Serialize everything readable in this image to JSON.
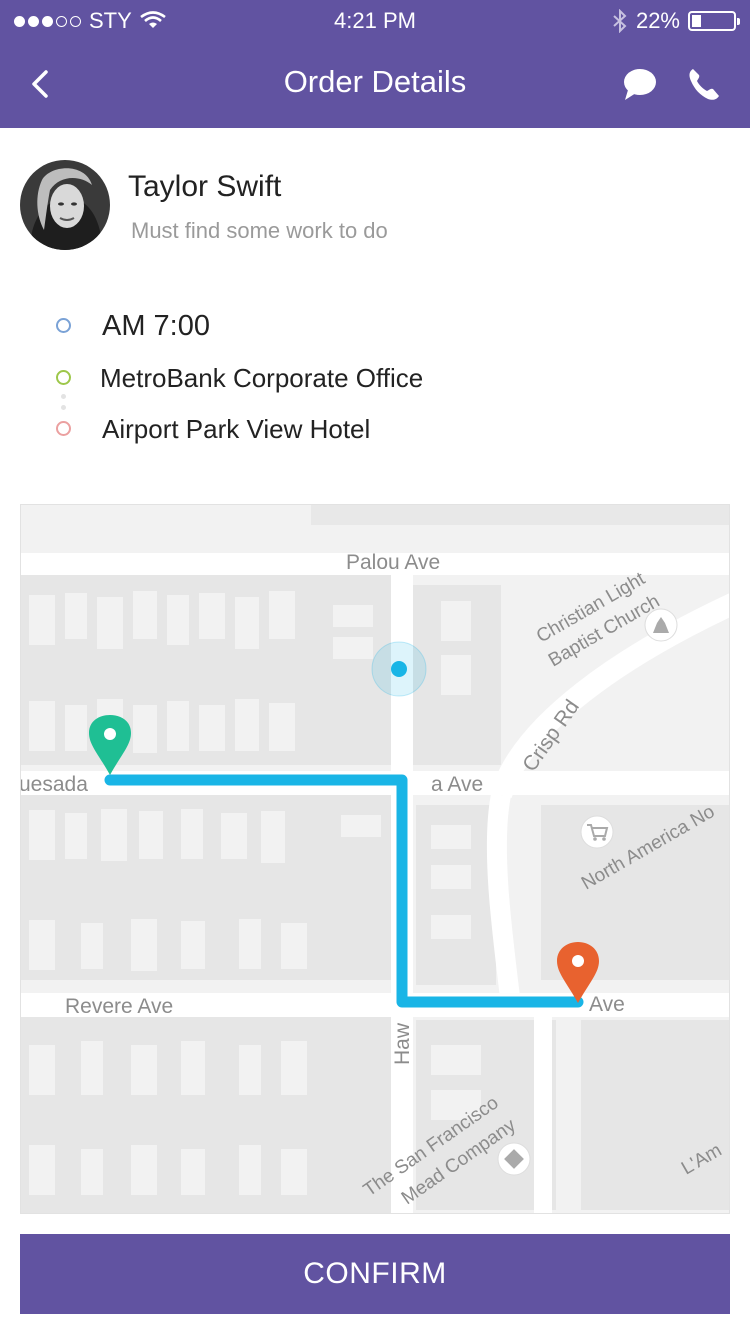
{
  "status_bar": {
    "carrier": "STY",
    "time": "4:21 PM",
    "battery_percent": "22%",
    "battery_level": 0.22
  },
  "nav": {
    "title": "Order Details",
    "back_icon": "chevron-left-icon",
    "chat_icon": "chat-bubble-icon",
    "phone_icon": "phone-icon"
  },
  "profile": {
    "name": "Taylor Swift",
    "tagline": "Must find some work to do"
  },
  "trip": {
    "time": "AM 7:00",
    "pickup": "MetroBank Corporate Office",
    "dropoff": "Airport Park View Hotel"
  },
  "map": {
    "streets": {
      "palou": "Palou Ave",
      "quesada_left": "uesada",
      "quesada_right": "a Ave",
      "revere_left": "Revere Ave",
      "revere_right": "Ave",
      "crisp": "Crisp Rd",
      "hawes": "Haw",
      "church_1": "Christian Light",
      "church_2": "Baptist Church",
      "north_america": "North America No",
      "mead_1": "The San Francisco",
      "mead_2": "Mead Company",
      "lam": "L'Am"
    }
  },
  "colors": {
    "brand": "#6153a1",
    "route": "#19b5e6",
    "start_pin": "#1fbf94",
    "end_pin": "#e8622f",
    "time_dot": "#7aa2d6",
    "pickup_dot": "#9dc74a",
    "dropoff_dot": "#eba0a0"
  },
  "confirm_label": "CONFIRM"
}
